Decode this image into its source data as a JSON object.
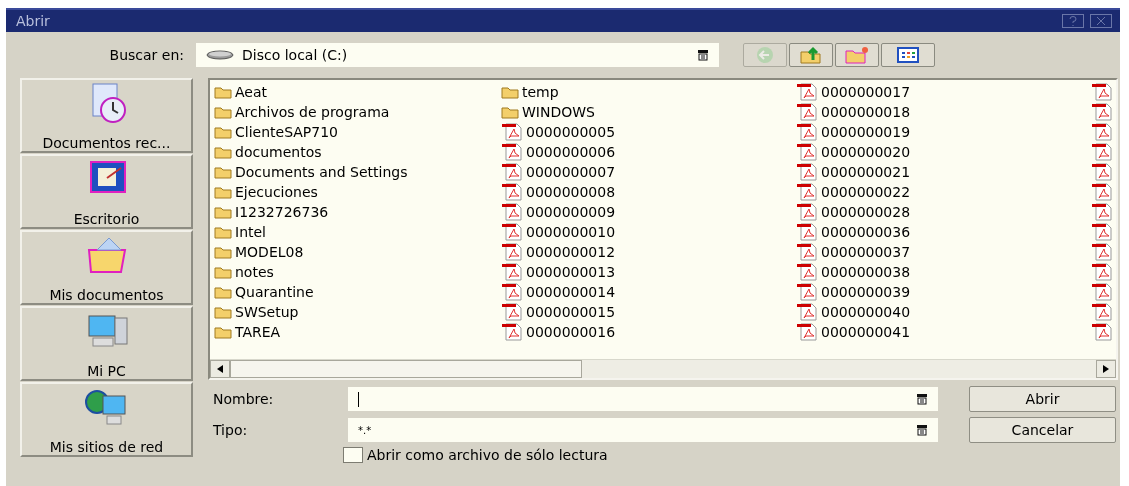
{
  "window": {
    "title": "Abrir"
  },
  "look_in": {
    "label": "Buscar en:",
    "value": "Disco local (C:)"
  },
  "toolbar": [
    {
      "kind": "back",
      "disabled": true
    },
    {
      "kind": "up",
      "disabled": false
    },
    {
      "kind": "new-folder",
      "disabled": false
    },
    {
      "kind": "view",
      "disabled": false
    }
  ],
  "places": [
    {
      "kind": "recent",
      "label": "Documentos rec..."
    },
    {
      "kind": "desktop",
      "label": "Escritorio"
    },
    {
      "kind": "documents",
      "label": "Mis documentos"
    },
    {
      "kind": "computer",
      "label": "Mi PC"
    },
    {
      "kind": "network",
      "label": "Mis sitios de red"
    }
  ],
  "file_columns": [
    [
      {
        "kind": "folder",
        "name": "Aeat"
      },
      {
        "kind": "folder",
        "name": "Archivos de programa"
      },
      {
        "kind": "folder",
        "name": "ClienteSAP710"
      },
      {
        "kind": "folder",
        "name": "documentos"
      },
      {
        "kind": "folder",
        "name": "Documents and Settings"
      },
      {
        "kind": "folder",
        "name": "Ejecuciones"
      },
      {
        "kind": "folder",
        "name": "I1232726736"
      },
      {
        "kind": "folder",
        "name": "Intel"
      },
      {
        "kind": "folder",
        "name": "MODEL08"
      },
      {
        "kind": "folder",
        "name": "notes"
      },
      {
        "kind": "folder",
        "name": "Quarantine"
      },
      {
        "kind": "folder",
        "name": "SWSetup"
      },
      {
        "kind": "folder",
        "name": "TAREA"
      }
    ],
    [
      {
        "kind": "folder",
        "name": "temp"
      },
      {
        "kind": "folder",
        "name": "WINDOWS"
      },
      {
        "kind": "pdf",
        "name": "0000000005"
      },
      {
        "kind": "pdf",
        "name": "0000000006"
      },
      {
        "kind": "pdf",
        "name": "0000000007"
      },
      {
        "kind": "pdf",
        "name": "0000000008"
      },
      {
        "kind": "pdf",
        "name": "0000000009"
      },
      {
        "kind": "pdf",
        "name": "0000000010"
      },
      {
        "kind": "pdf",
        "name": "0000000012"
      },
      {
        "kind": "pdf",
        "name": "0000000013"
      },
      {
        "kind": "pdf",
        "name": "0000000014"
      },
      {
        "kind": "pdf",
        "name": "0000000015"
      },
      {
        "kind": "pdf",
        "name": "0000000016"
      }
    ],
    [
      {
        "kind": "pdf",
        "name": "0000000017"
      },
      {
        "kind": "pdf",
        "name": "0000000018"
      },
      {
        "kind": "pdf",
        "name": "0000000019"
      },
      {
        "kind": "pdf",
        "name": "0000000020"
      },
      {
        "kind": "pdf",
        "name": "0000000021"
      },
      {
        "kind": "pdf",
        "name": "0000000022"
      },
      {
        "kind": "pdf",
        "name": "0000000028"
      },
      {
        "kind": "pdf",
        "name": "0000000036"
      },
      {
        "kind": "pdf",
        "name": "0000000037"
      },
      {
        "kind": "pdf",
        "name": "0000000038"
      },
      {
        "kind": "pdf",
        "name": "0000000039"
      },
      {
        "kind": "pdf",
        "name": "0000000040"
      },
      {
        "kind": "pdf",
        "name": "0000000041"
      }
    ],
    [
      {
        "kind": "pdf"
      },
      {
        "kind": "pdf"
      },
      {
        "kind": "pdf"
      },
      {
        "kind": "pdf"
      },
      {
        "kind": "pdf"
      },
      {
        "kind": "pdf"
      },
      {
        "kind": "pdf"
      },
      {
        "kind": "pdf"
      },
      {
        "kind": "pdf"
      },
      {
        "kind": "pdf"
      },
      {
        "kind": "pdf"
      },
      {
        "kind": "pdf"
      },
      {
        "kind": "pdf"
      }
    ]
  ],
  "file_name": {
    "label": "Nombre:"
  },
  "file_type": {
    "label": "Tipo:",
    "value": "*.*"
  },
  "read_only": {
    "label": "Abrir como archivo de sólo lectura",
    "checked": false
  },
  "buttons": [
    {
      "label": "Abrir"
    },
    {
      "label": "Cancelar"
    }
  ]
}
